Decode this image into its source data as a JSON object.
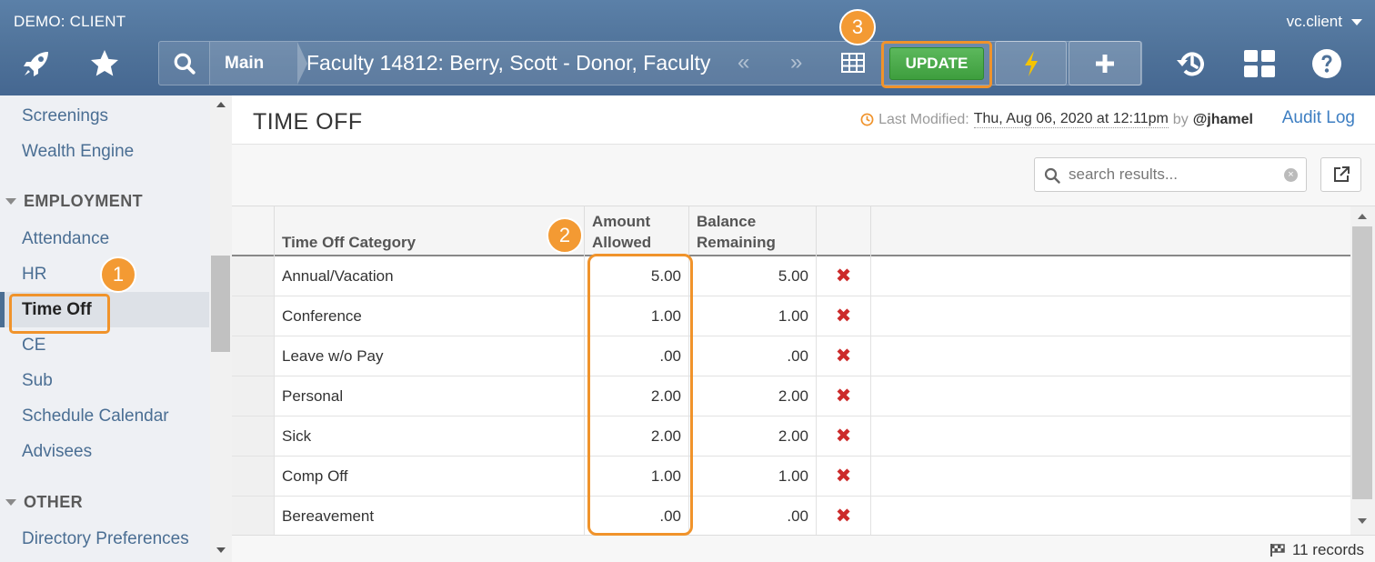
{
  "header": {
    "client_label": "DEMO: CLIENT",
    "user_name": "vc.client",
    "icons": [
      "rocket-icon",
      "star-icon",
      "search-icon",
      "table-icon",
      "lightning-icon",
      "plus-icon",
      "history-icon",
      "dashboard-icon",
      "help-icon"
    ],
    "breadcrumb": {
      "main": "Main",
      "record_title": "Faculty 14812: Berry, Scott - Donor, Faculty",
      "prev": "«",
      "next": "»"
    },
    "update_label": "UPDATE"
  },
  "markers": {
    "one": "1",
    "two": "2",
    "three": "3"
  },
  "sidebar": {
    "items_top": [
      "Screenings",
      "Wealth Engine"
    ],
    "section_employment": "EMPLOYMENT",
    "employment_items": [
      "Attendance",
      "HR",
      "Time Off",
      "CE",
      "Sub",
      "Schedule Calendar",
      "Advisees"
    ],
    "active_item": "Time Off",
    "section_other": "OTHER",
    "other_items": [
      "Directory Preferences"
    ]
  },
  "page": {
    "title": "TIME OFF",
    "last_modified_label": "Last Modified:",
    "last_modified_date": "Thu, Aug 06, 2020 at 12:11pm",
    "by_label": "by",
    "modified_by": "@jhamel",
    "audit_log": "Audit Log"
  },
  "search": {
    "placeholder": "search results..."
  },
  "table": {
    "columns": {
      "category": "Time Off Category",
      "amount_line1": "Amount",
      "amount_line2": "Allowed",
      "balance_line1": "Balance",
      "balance_line2": "Remaining"
    },
    "rows": [
      {
        "category": "Annual/Vacation",
        "amount": "5.00",
        "balance": "5.00"
      },
      {
        "category": "Conference",
        "amount": "1.00",
        "balance": "1.00"
      },
      {
        "category": "Leave w/o Pay",
        "amount": ".00",
        "balance": ".00"
      },
      {
        "category": "Personal",
        "amount": "2.00",
        "balance": "2.00"
      },
      {
        "category": "Sick",
        "amount": "2.00",
        "balance": "2.00"
      },
      {
        "category": "Comp Off",
        "amount": "1.00",
        "balance": "1.00"
      },
      {
        "category": "Bereavement",
        "amount": ".00",
        "balance": ".00"
      }
    ],
    "delete_glyph": "✖"
  },
  "footer": {
    "records": "11 records"
  },
  "colors": {
    "header_blue": "#4f7299",
    "accent_orange": "#f0932b",
    "update_green": "#4cae4c",
    "delete_red": "#cc2a2a",
    "link_blue": "#4a6e93"
  }
}
